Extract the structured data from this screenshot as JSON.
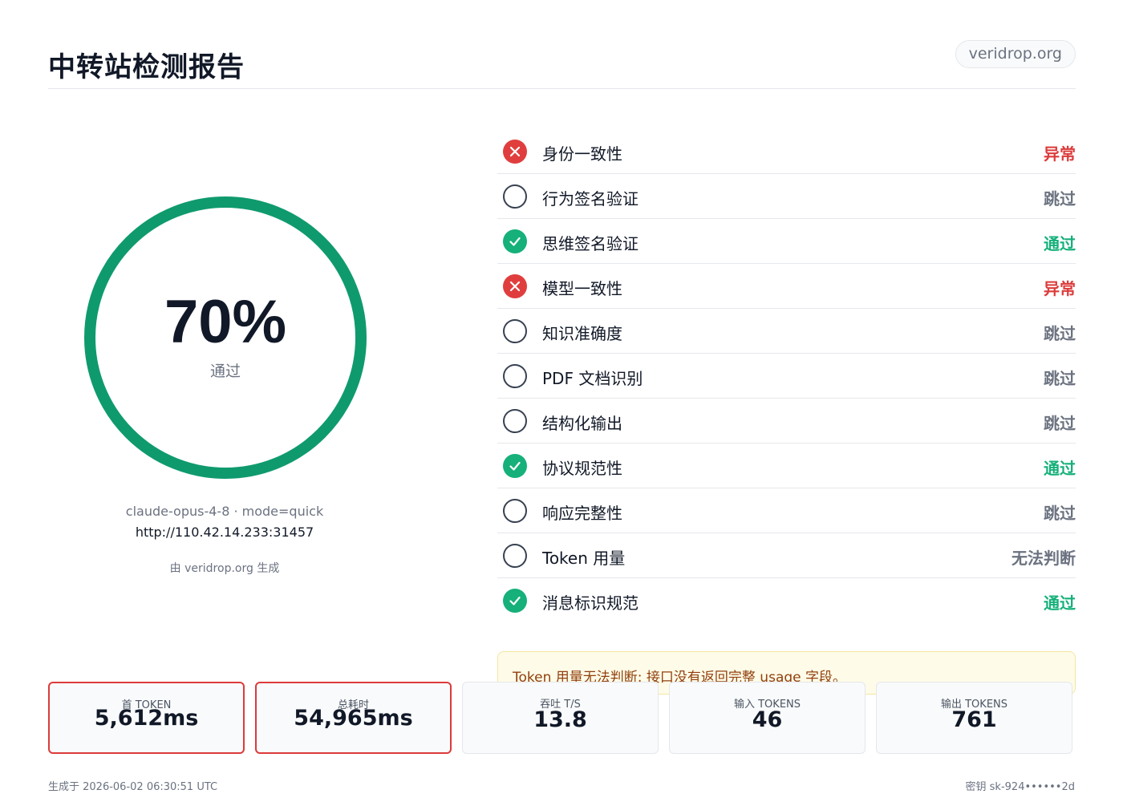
{
  "header": {
    "title": "中转站检测报告",
    "domain": "veridrop.org"
  },
  "gauge": {
    "percent_label": "70%",
    "percent_value": 0.7,
    "status_label": "通过",
    "ring_color": "#0f9a6e"
  },
  "meta": {
    "model_line": "claude-opus-4-8 · mode=quick",
    "url": "http://110.42.14.233:31457",
    "generated_by": "由 veridrop.org 生成"
  },
  "checks": [
    {
      "name": "身份一致性",
      "result": "异常",
      "status": "fail",
      "icon": "x-circle-icon"
    },
    {
      "name": "行为签名验证",
      "result": "跳过",
      "status": "skip",
      "icon": "empty-circle-icon"
    },
    {
      "name": "思维签名验证",
      "result": "通过",
      "status": "pass",
      "icon": "check-circle-icon"
    },
    {
      "name": "模型一致性",
      "result": "异常",
      "status": "fail",
      "icon": "x-circle-icon"
    },
    {
      "name": "知识准确度",
      "result": "跳过",
      "status": "skip",
      "icon": "empty-circle-icon"
    },
    {
      "name": "PDF 文档识别",
      "result": "跳过",
      "status": "skip",
      "icon": "empty-circle-icon"
    },
    {
      "name": "结构化输出",
      "result": "跳过",
      "status": "skip",
      "icon": "empty-circle-icon"
    },
    {
      "name": "协议规范性",
      "result": "通过",
      "status": "pass",
      "icon": "check-circle-icon"
    },
    {
      "name": "响应完整性",
      "result": "跳过",
      "status": "skip",
      "icon": "empty-circle-icon"
    },
    {
      "name": "Token 用量",
      "result": "无法判断",
      "status": "skip",
      "icon": "empty-circle-icon"
    },
    {
      "name": "消息标识规范",
      "result": "通过",
      "status": "pass",
      "icon": "check-circle-icon"
    }
  ],
  "notice": {
    "text": "Token 用量无法判断: 接口没有返回完整 usage 字段。"
  },
  "stats": [
    {
      "label": "首 TOKEN",
      "value": "5,612ms",
      "alert": true
    },
    {
      "label": "总耗时",
      "value": "54,965ms",
      "alert": true
    },
    {
      "label": "吞吐 T/S",
      "value": "13.8",
      "alert": false
    },
    {
      "label": "输入 TOKENS",
      "value": "46",
      "alert": false
    },
    {
      "label": "输出 TOKENS",
      "value": "761",
      "alert": false
    }
  ],
  "footer": {
    "generated_at": "生成于 2026-06-02 06:30:51 UTC",
    "key": "密钥 sk-924••••••2d"
  },
  "colors": {
    "fail": "#dc3b3b",
    "pass": "#16b07a",
    "skip": "#6b7280"
  }
}
